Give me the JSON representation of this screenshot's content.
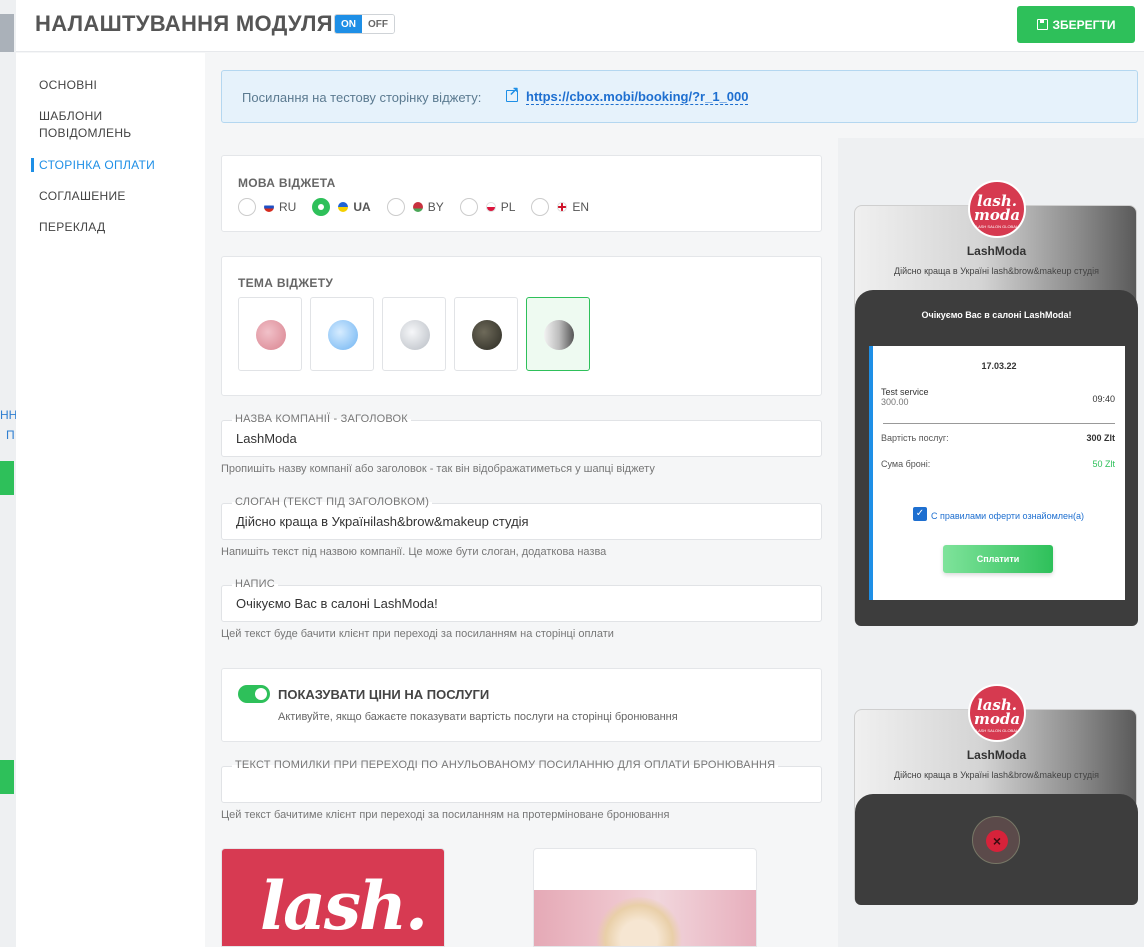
{
  "header": {
    "title": "НАЛАШТУВАННЯ МОДУЛЯ",
    "toggle_on": "ON",
    "toggle_off": "OFF",
    "save_label": "ЗБЕРЕГТИ"
  },
  "bg_page": {
    "frag1": "НН",
    "frag2": "П"
  },
  "sidebar": {
    "items": [
      {
        "label": "ОСНОВНІ"
      },
      {
        "label": "ШАБЛОНИ ПОВІДОМЛЕНЬ"
      },
      {
        "label": "СТОРІНКА ОПЛАТИ",
        "active": true
      },
      {
        "label": "СОГЛАШЕНИЕ"
      },
      {
        "label": "ПЕРЕКЛАД"
      }
    ]
  },
  "link_box": {
    "label": "Посилання на тестову сторінку віджету:",
    "url": "https://cbox.mobi/booking/?r_1_000"
  },
  "language": {
    "heading": "МОВА ВІДЖЕТА",
    "options": [
      {
        "code": "RU",
        "checked": false
      },
      {
        "code": "UA",
        "checked": true
      },
      {
        "code": "BY",
        "checked": false
      },
      {
        "code": "PL",
        "checked": false
      },
      {
        "code": "EN",
        "checked": false
      }
    ]
  },
  "theme": {
    "heading": "ТЕМА ВІДЖЕТУ",
    "swatches": [
      "pink",
      "blue",
      "silver",
      "dark",
      "gray-gradient"
    ],
    "selected": "gray-gradient"
  },
  "company": {
    "legend": "НАЗВА КОМПАНІЇ - ЗАГОЛОВОК",
    "value": "LashModa",
    "hint": "Пропишіть назву компанії або заголовок - так він відображатиметься у шапці віджету"
  },
  "slogan": {
    "legend": "СЛОГАН (ТЕКСТ ПІД ЗАГОЛОВКОМ)",
    "value": "Дійсно краща в Україніlash&brow&makeup студія",
    "hint": "Напишіть текст під назвою компанії. Це може бути слоган, додаткова назва"
  },
  "caption": {
    "legend": "НАПИС",
    "value": "Очікуємо Вас в салоні LashModa!",
    "hint": "Цей текст буде бачити клієнт при переході за посиланням на сторінці оплати"
  },
  "prices": {
    "title": "ПОКАЗУВАТИ ЦІНИ НА ПОСЛУГИ",
    "desc": "Активуйте, якщо бажаєте показувати вартість послуги на сторінці бронювання",
    "enabled": true
  },
  "error_text": {
    "legend": "ТЕКСТ ПОМИЛКИ ПРИ ПЕРЕХОДІ ПО АНУЛЬОВАНОМУ ПОСИЛАННЮ ДЛЯ ОПЛАТИ БРОНЮВАННЯ",
    "value": "",
    "hint": "Цей текст бачитиме клієнт при переході за посиланням на протерміноване бронювання"
  },
  "images": {
    "logo_word": "lash."
  },
  "preview": {
    "logo_text": "lash. moda",
    "logo_sub": "LASH SALON GLOBAL",
    "name": "LashModa",
    "slogan": "Дійсно краща в Україні lash&brow&makeup студія",
    "greeting": "Очікуємо Вас в салоні LashModa!",
    "date": "17.03.22",
    "service": "Test service",
    "service_price": "300.00",
    "time": "09:40",
    "cost_label": "Вартість послуг:",
    "cost_value": "300 Zlt",
    "deposit_label": "Сума броні:",
    "deposit_value": "50 Zlt",
    "agree": "С правилами оферти ознайомлен(а)",
    "pay": "Сплатити"
  }
}
